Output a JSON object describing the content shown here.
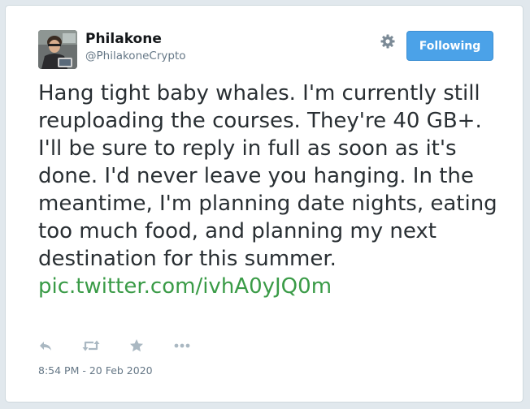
{
  "user": {
    "name": "Philakone",
    "handle": "@PhilakoneCrypto"
  },
  "follow_button": {
    "label": "Following"
  },
  "tweet": {
    "text": "Hang tight baby whales. I'm currently still reuploading the courses. They're 40 GB+. I'll be sure to reply in full as soon as it's done. I'd never leave you hanging. In the meantime, I'm planning date nights, eating too much food, and planning my next destination for this summer.",
    "link": "pic.twitter.com/ivhA0yJQ0m",
    "timestamp": "8:54 PM - 20 Feb 2020"
  },
  "icons": {
    "settings": "gear-icon",
    "reply": "reply-icon",
    "retweet": "retweet-icon",
    "favorite": "star-icon",
    "more": "more-icon"
  },
  "colors": {
    "follow_button": "#4ba2e8",
    "link": "#3a9b47",
    "secondary_text": "#657786",
    "action_icons": "#aab8c2"
  }
}
